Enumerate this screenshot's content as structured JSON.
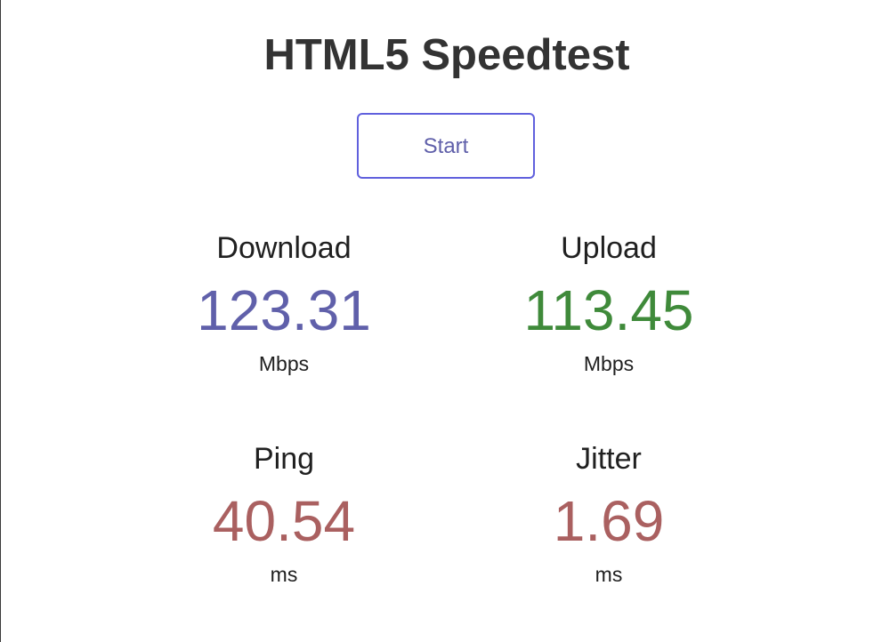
{
  "header": {
    "title": "HTML5 Speedtest"
  },
  "controls": {
    "start_label": "Start"
  },
  "colors": {
    "download": "#6060aa",
    "upload": "#3f8a3a",
    "latency": "#aa6060"
  },
  "metrics": {
    "download": {
      "label": "Download",
      "value": "123.31",
      "unit": "Mbps"
    },
    "upload": {
      "label": "Upload",
      "value": "113.45",
      "unit": "Mbps"
    },
    "ping": {
      "label": "Ping",
      "value": "40.54",
      "unit": "ms"
    },
    "jitter": {
      "label": "Jitter",
      "value": "1.69",
      "unit": "ms"
    }
  }
}
